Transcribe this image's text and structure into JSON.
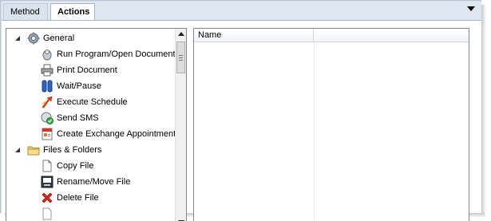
{
  "tabs": [
    {
      "label": "Method"
    },
    {
      "label": "Actions"
    }
  ],
  "tree": {
    "groups": [
      {
        "label": "General",
        "icon": "gear-icon"
      },
      {
        "label": "Files & Folders",
        "icon": "folder-icon"
      }
    ],
    "items": [
      {
        "label": "Run Program/Open Document",
        "icon": "run-program-icon"
      },
      {
        "label": "Print Document",
        "icon": "printer-icon"
      },
      {
        "label": "Wait/Pause",
        "icon": "pause-icon"
      },
      {
        "label": "Execute Schedule",
        "icon": "execute-schedule-icon"
      },
      {
        "label": "Send SMS",
        "icon": "sms-icon"
      },
      {
        "label": "Create Exchange Appointment",
        "icon": "exchange-appointment-icon"
      },
      {
        "label": "Copy File",
        "icon": "copy-file-icon"
      },
      {
        "label": "Rename/Move File",
        "icon": "rename-file-icon"
      },
      {
        "label": "Delete File",
        "icon": "delete-icon"
      }
    ]
  },
  "grid": {
    "columns": [
      {
        "label": "Name"
      }
    ]
  }
}
